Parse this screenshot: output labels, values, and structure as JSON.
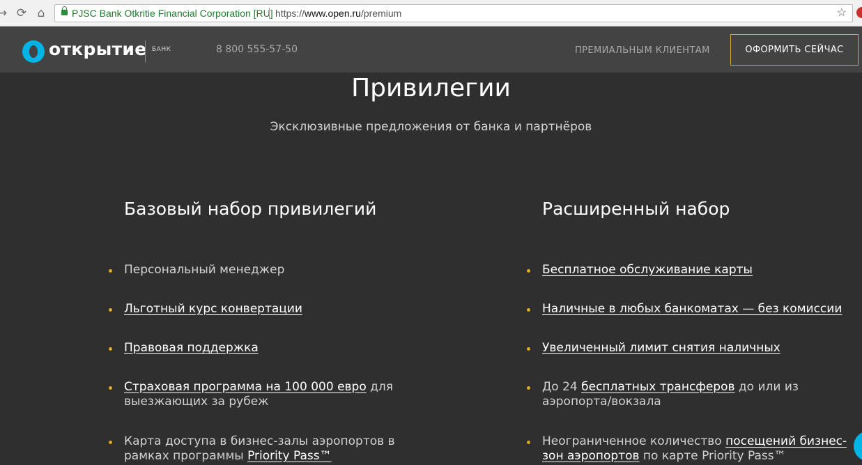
{
  "browser": {
    "back_icon": "back-arrow-icon",
    "reload_icon": "reload-icon",
    "home_icon": "home-icon",
    "cert_label": "PJSC Bank Otkritie Financial Corporation [RU]",
    "url_scheme": "https://",
    "url_host": "www.open.ru",
    "url_path": "/premium"
  },
  "header": {
    "logo_text": "открытие",
    "logo_bank": "БАНК",
    "phone": "8 800 555-57-50",
    "nav_premium": "ПРЕМИАЛЬНЫМ КЛИЕНТАМ",
    "cta": "ОФОРМИТЬ СЕЙЧАС",
    "brand_color": "#00b4e6",
    "cta_border_color": "#d4ac2a"
  },
  "main": {
    "title": "Привилегии",
    "subtitle": "Эксклюзивные предложения от банка и партнёров"
  },
  "basic": {
    "title": "Базовый набор привилегий",
    "i1": "Персональный менеджер",
    "i2": "Льготный курс конвертации",
    "i3": "Правовая поддержка",
    "i4_link": "Страховая программа на 100 000 евро",
    "i4_rest": " для выезжающих за рубеж",
    "i5_text": "Карта доступа в бизнес-залы аэропортов в рамках программы ",
    "i5_link": "Priority Pass™"
  },
  "extended": {
    "title": "Расширенный набор",
    "i1": "Бесплатное обслуживание карты",
    "i2": "Наличные в любых банкоматах — без комиссии",
    "i3": "Увеличенный лимит снятия наличных",
    "i4_pre": "До 24 ",
    "i4_link": "бесплатных трансферов",
    "i4_rest": " до или из аэропорта/вокзала",
    "i5_pre": "Неограниченное количество ",
    "i5_link": "посещений бизнес-зон аэропортов",
    "i5_rest": " по карте Priority Pass™"
  },
  "bullet_color": "#e0a720"
}
